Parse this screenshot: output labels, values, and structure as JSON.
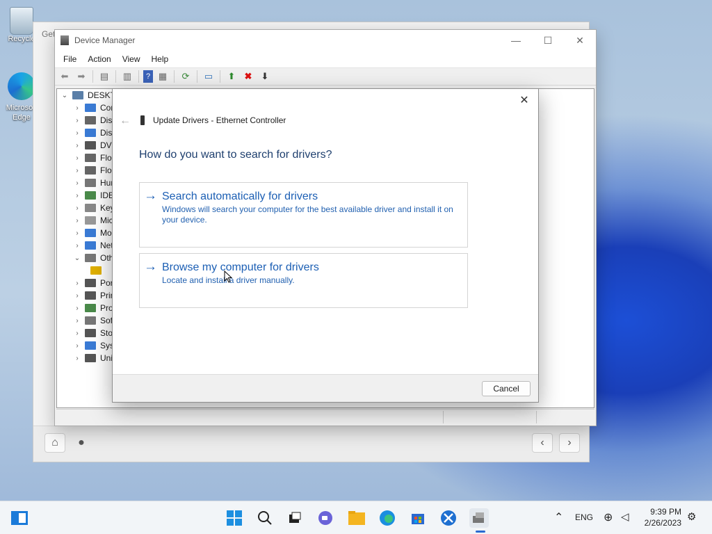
{
  "desktop": {
    "icons": [
      {
        "label": "Recycle"
      },
      {
        "label": "Microsoft Edge"
      }
    ]
  },
  "back_window": {
    "title": "Get"
  },
  "device_manager": {
    "title": "Device Manager",
    "menu": [
      "File",
      "Action",
      "View",
      "Help"
    ],
    "tree": {
      "root": "DESKTOP",
      "items": [
        {
          "label": "Computer",
          "icon_color": "#3a7bd5"
        },
        {
          "label": "Disk drives",
          "icon_color": "#666666"
        },
        {
          "label": "Display adapters",
          "icon_color": "#3a7bd5"
        },
        {
          "label": "DVD/CD-ROM drives",
          "icon_color": "#555555"
        },
        {
          "label": "Floppy disk controllers",
          "icon_color": "#666666"
        },
        {
          "label": "Floppy drive controllers",
          "icon_color": "#666666"
        },
        {
          "label": "Human Interface Devices",
          "icon_color": "#777777"
        },
        {
          "label": "IDE ATA/ATAPI controllers",
          "icon_color": "#4a8a4a"
        },
        {
          "label": "Keyboards",
          "icon_color": "#888888"
        },
        {
          "label": "Mice and other pointing devices",
          "icon_color": "#999999"
        },
        {
          "label": "Monitors",
          "icon_color": "#3a7bd5"
        },
        {
          "label": "Network adapters",
          "icon_color": "#3a7bd5"
        },
        {
          "label": "Other devices",
          "icon_color": "#777777",
          "expanded": true
        },
        {
          "label": "",
          "icon_color": "#e0b000",
          "child": true,
          "warning": true
        },
        {
          "label": "Ports (COM & LPT)",
          "icon_color": "#555555"
        },
        {
          "label": "Print queues",
          "icon_color": "#555555"
        },
        {
          "label": "Processors",
          "icon_color": "#4a8a4a"
        },
        {
          "label": "Software devices",
          "icon_color": "#777777"
        },
        {
          "label": "Storage controllers",
          "icon_color": "#555555"
        },
        {
          "label": "System devices",
          "icon_color": "#3a7bd5"
        },
        {
          "label": "Universal Serial Bus controllers",
          "icon_color": "#555555"
        }
      ]
    },
    "visible_labels": [
      "DESKTO",
      "Cor",
      "Disk",
      "Disp",
      "DVD",
      "Flop",
      "Flop",
      "Hun",
      "IDE",
      "Key",
      "Mic",
      "Mo",
      "Net",
      "Oth",
      "",
      "Por",
      "Prin",
      "Pro",
      "Soft",
      "Stor",
      "Syst",
      "Uni"
    ]
  },
  "dialog": {
    "header": "Update Drivers - Ethernet Controller",
    "question": "How do you want to search for drivers?",
    "options": [
      {
        "title": "Search automatically for drivers",
        "desc": "Windows will search your computer for the best available driver and install it on your device."
      },
      {
        "title": "Browse my computer for drivers",
        "desc": "Locate and install a driver manually."
      }
    ],
    "cancel_label": "Cancel"
  },
  "taskbar": {
    "tray_lang": "ENG",
    "time": "9:39 PM",
    "date": "2/26/2023",
    "apps": [
      "start-icon",
      "search-icon",
      "task-view-icon",
      "chat-icon",
      "file-explorer-icon",
      "edge-icon",
      "store-icon",
      "snipping-icon",
      "device-manager-icon"
    ]
  },
  "colors": {
    "accent": "#1c5fb4",
    "win_blue": "#1a3fb8"
  }
}
